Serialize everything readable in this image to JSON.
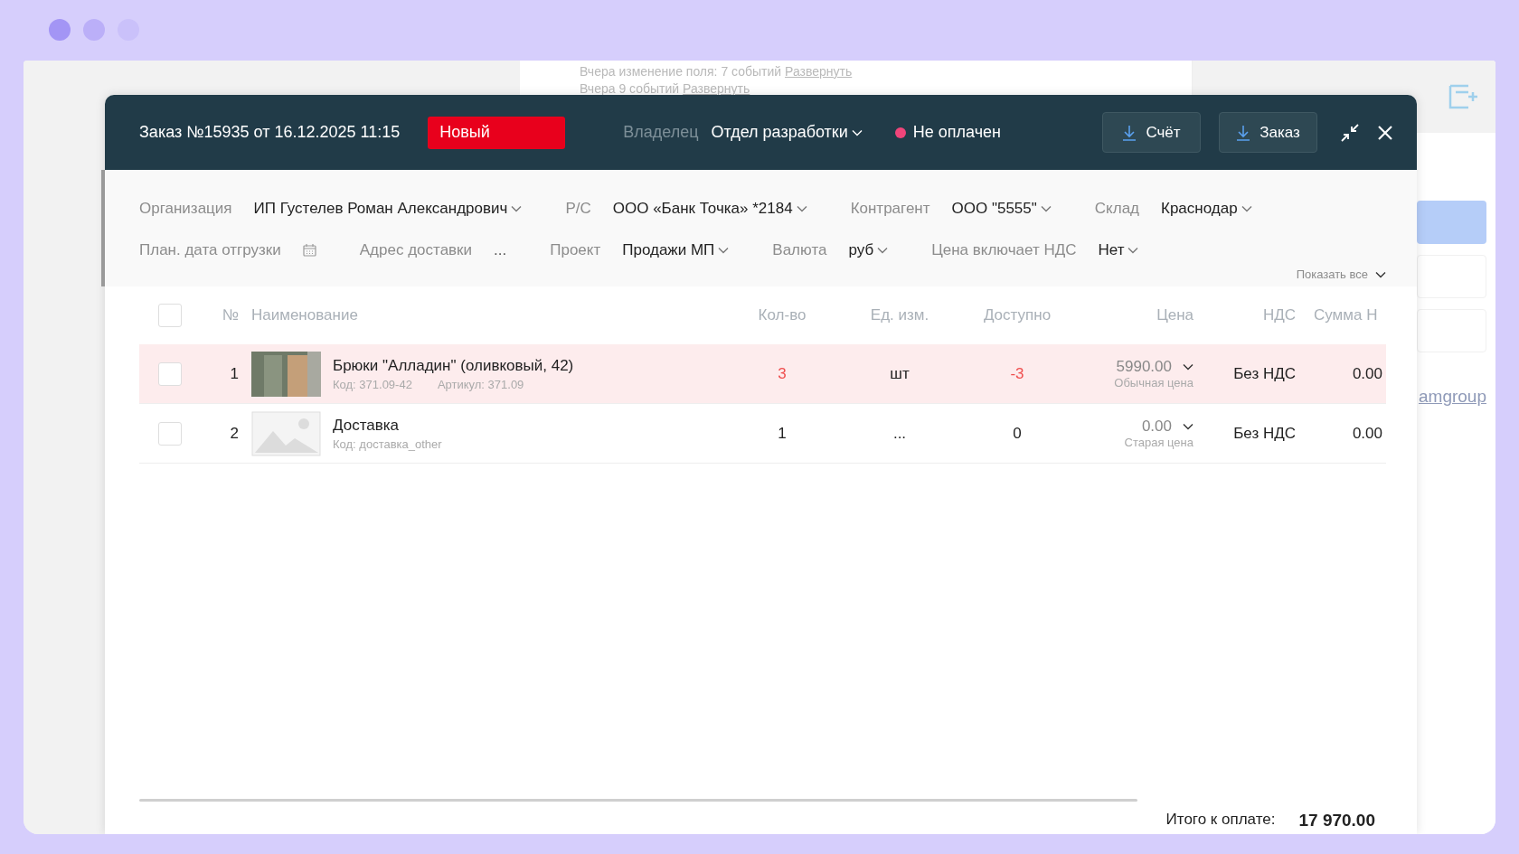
{
  "background": {
    "history": [
      {
        "text": "Вчера изменение поля: 7 событий",
        "link": "Развернуть"
      },
      {
        "text": "Вчера 9 событий",
        "link": "Развернуть"
      }
    ],
    "side_link": "amgroup"
  },
  "order": {
    "title": "Заказ №15935 от 16.12.2025 11:15",
    "status": "Новый",
    "owner_label": "Владелец",
    "owner": "Отдел разработки",
    "payment": {
      "label": "Не оплачен",
      "color": "#f0457a"
    },
    "buttons": [
      "Счёт",
      "Заказ"
    ]
  },
  "fields": [
    [
      {
        "label": "Организация",
        "value": "ИП Густелев Роман Александрович",
        "kind": "dropdown"
      },
      {
        "label": "Р/С",
        "value": "ООО «Банк Точка» *2184",
        "kind": "dropdown"
      },
      {
        "label": "Контрагент",
        "value": "ООО \"5555\"",
        "kind": "dropdown"
      },
      {
        "label": "Склад",
        "value": "Краснодар",
        "kind": "dropdown"
      }
    ],
    [
      {
        "label": "План. дата отгрузки",
        "kind": "date"
      },
      {
        "label": "Адрес доставки",
        "value": "...",
        "kind": "text"
      },
      {
        "label": "Проект",
        "value": "Продажи МП",
        "kind": "dropdown"
      },
      {
        "label": "Валюта",
        "value": "руб",
        "kind": "dropdown"
      },
      {
        "label": "Цена включает НДС",
        "value": "Нет",
        "kind": "dropdown"
      }
    ]
  ],
  "show_all": "Показать все",
  "table": {
    "all_selected": false,
    "columns": [
      "№",
      "Наименование",
      "Кол-во",
      "Ед. изм.",
      "Доступно",
      "Цена",
      "НДС",
      "Сумма Н"
    ],
    "rows": [
      {
        "selected": false,
        "shortage": true,
        "number": "1",
        "kind": "photo",
        "name": "Брюки \"Алладин\" (оливковый, 42)",
        "code": "Код: 371.09-42",
        "article": "Артикул: 371.09",
        "qty": "3",
        "unit": "шт",
        "available": "-3",
        "price": "5990.00",
        "price_type": "Обычная цена",
        "vat": "Без НДС",
        "vat_sum": "0.00"
      },
      {
        "selected": false,
        "shortage": false,
        "number": "2",
        "kind": "placeholder",
        "name": "Доставка",
        "code": "Код: доставка_other",
        "qty": "1",
        "unit": "...",
        "available": "0",
        "price": "0.00",
        "price_type": "Старая цена",
        "vat": "Без НДС",
        "vat_sum": "0.00"
      }
    ]
  },
  "total": {
    "label": "Итого к оплате:",
    "value": "17 970.00"
  }
}
